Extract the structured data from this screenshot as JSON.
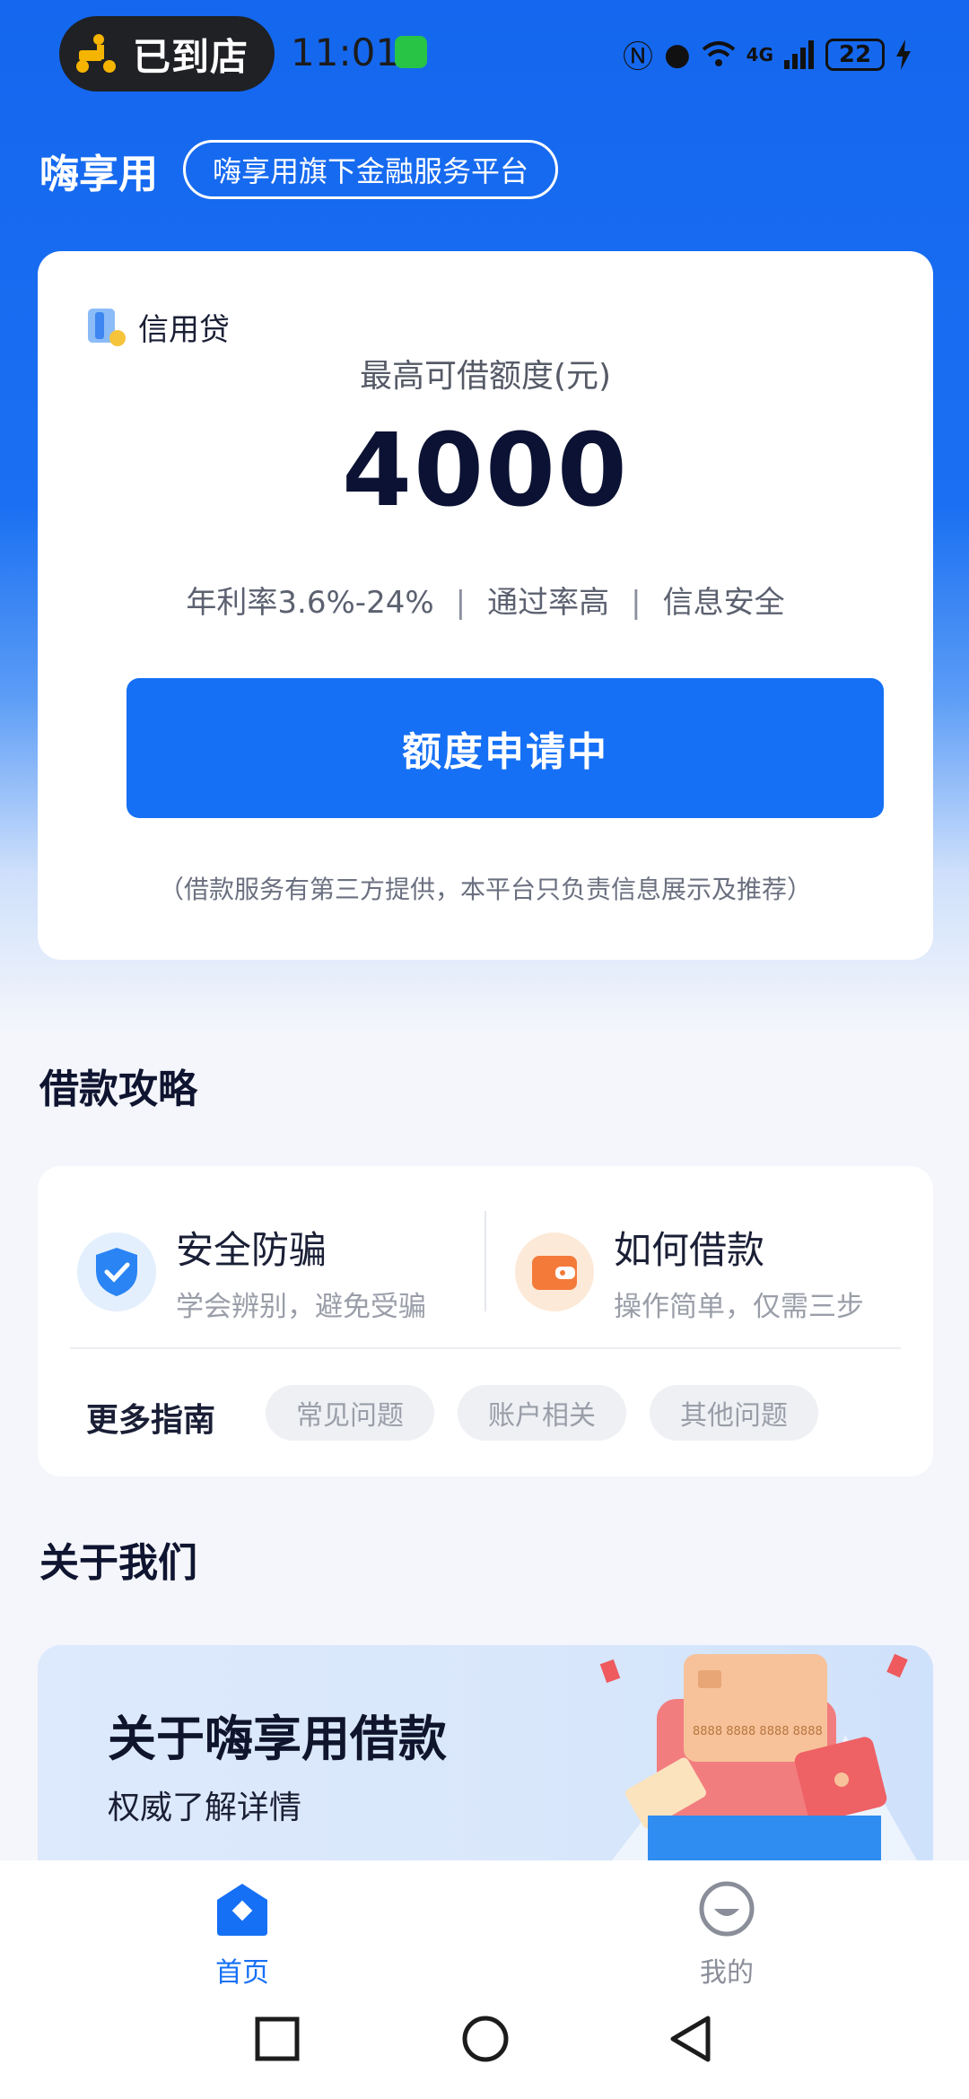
{
  "status_bar": {
    "pill_text": "已到店",
    "time": "11:01",
    "signal": "4G",
    "battery": "22"
  },
  "header": {
    "brand": "嗨享用",
    "tagline": "嗨享用旗下金融服务平台"
  },
  "loan_card": {
    "type_label": "信用贷",
    "limit_title": "最高可借额度(元)",
    "limit_amount": "4000",
    "features": [
      "年利率3.6%-24%",
      "通过率高",
      "信息安全"
    ],
    "apply_button": "额度申请中",
    "disclaimer": "（借款服务有第三方提供，本平台只负责信息展示及推荐）"
  },
  "guide": {
    "section_title": "借款攻略",
    "items": [
      {
        "title": "安全防骗",
        "subtitle": "学会辨别，避免受骗"
      },
      {
        "title": "如何借款",
        "subtitle": "操作简单，仅需三步"
      }
    ],
    "more_label": "更多指南",
    "chips": [
      "常见问题",
      "账户相关",
      "其他问题"
    ]
  },
  "about": {
    "section_title": "关于我们",
    "banner_title": "关于嗨享用借款",
    "banner_subtitle": "权威了解详情",
    "card_text": "8888 8888 8888 8888"
  },
  "bottom_nav": {
    "home_label": "首页",
    "me_label": "我的"
  },
  "colors": {
    "primary": "#1570f5",
    "header_blue": "#1467ee"
  }
}
